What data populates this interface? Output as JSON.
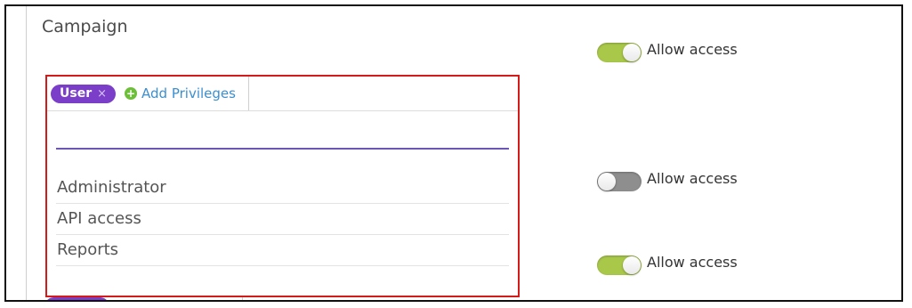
{
  "section": {
    "title": "Campaign"
  },
  "toggles": [
    {
      "label": "Allow access",
      "state": "on",
      "color": "#a9c84a"
    },
    {
      "label": "Allow access",
      "state": "off",
      "color": "#8e8e8e"
    },
    {
      "label": "Allow access",
      "state": "on",
      "color": "#a9c84a"
    }
  ],
  "privileges": {
    "chip_label": "User",
    "chip_remove": "×",
    "add_label": "Add Privileges",
    "add_icon": "+"
  },
  "dropdown": {
    "options": [
      "Administrator",
      "API access",
      "Reports"
    ]
  },
  "colors": {
    "chip": "#7a3ec9",
    "link": "#3b8fd0",
    "highlight_border": "#d51a1a",
    "search_underline": "#6b56b8"
  }
}
